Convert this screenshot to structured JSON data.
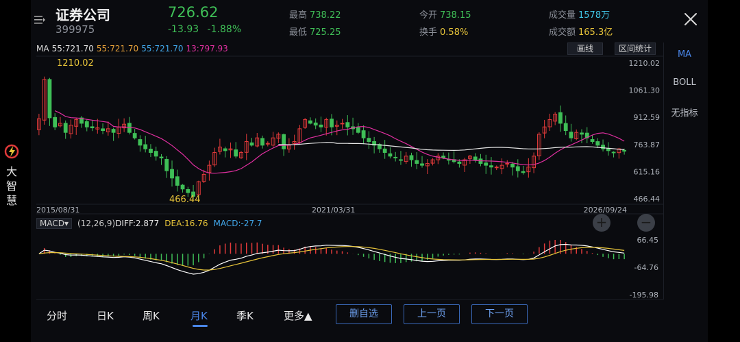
{
  "brand": {
    "chars": [
      "大",
      "智",
      "慧"
    ],
    "logo_icon": "lightning-logo-icon"
  },
  "header": {
    "name": "证券公司",
    "code": "399975",
    "price": "726.62",
    "change": "-13.93",
    "change_pct": "-1.88%",
    "high_label": "最高",
    "high": "738.22",
    "low_label": "最低",
    "low": "725.25",
    "open_label": "今开",
    "open": "738.15",
    "turnover_label": "换手",
    "turnover": "0.58%",
    "volume_label": "成交量",
    "volume": "1578万",
    "amount_label": "成交额",
    "amount": "165.3亿"
  },
  "ma_legend": {
    "label": "MA",
    "items": [
      {
        "text": "55:721.70",
        "color": "#e0e0e0"
      },
      {
        "text": "55:721.70",
        "color": "#e8a23a"
      },
      {
        "text": "55:721.70",
        "color": "#41a6e8"
      },
      {
        "text": "13:797.93",
        "color": "#e02fa0"
      }
    ]
  },
  "tools": {
    "draw": "画线",
    "range": "区间统计"
  },
  "indicators": [
    {
      "label": "MA",
      "active": true
    },
    {
      "label": "BOLL",
      "active": false
    },
    {
      "label": "无指标",
      "active": false
    }
  ],
  "macd": {
    "select_label": "MACD",
    "params": "(12,26,9)",
    "diff": "DIFF:2.877",
    "dea": "DEA:16.76",
    "macd": "MACD:-27.7",
    "zoom_in": "+",
    "zoom_out": "−"
  },
  "tabs": [
    {
      "label": "分时",
      "active": false
    },
    {
      "label": "日K",
      "active": false
    },
    {
      "label": "周K",
      "active": false
    },
    {
      "label": "月K",
      "active": true
    },
    {
      "label": "季K",
      "active": false
    },
    {
      "label": "更多▲",
      "active": false
    }
  ],
  "actions": {
    "remove_fav": "删自选",
    "prev": "上一页",
    "next": "下一页"
  },
  "chart_data": {
    "type": "candlestick",
    "price_axis": [
      "1210.02",
      "1061.30",
      "912.59",
      "763.87",
      "615.16",
      "466.44"
    ],
    "price_range": [
      466.44,
      1210.02
    ],
    "dates": [
      "2015/08/31",
      "2021/03/31",
      "2026/09/24"
    ],
    "annotations": {
      "max": "1210.02",
      "min": "466.44"
    },
    "macd_axis": [
      "66.45",
      "-64.76",
      "-195.98"
    ],
    "macd_range": [
      -195.98,
      66.45
    ],
    "colors": {
      "up": "#e23a3a",
      "down": "#3fbf57",
      "ma_white": "#e6e6e6",
      "ma13": "#e02fa0",
      "dif": "#ffffff",
      "dea": "#e8c53a"
    },
    "close": [
      905,
      1120,
      910,
      860,
      880,
      830,
      870,
      900,
      880,
      860,
      855,
      855,
      840,
      850,
      830,
      860,
      875,
      830,
      800,
      760,
      740,
      720,
      700,
      690,
      620,
      580,
      540,
      520,
      500,
      480,
      560,
      600,
      650,
      720,
      750,
      730,
      740,
      700,
      720,
      780,
      760,
      800,
      760,
      770,
      800,
      820,
      740,
      760,
      780,
      850,
      900,
      880,
      870,
      860,
      900,
      860,
      870,
      880,
      860,
      850,
      830,
      800,
      780,
      760,
      740,
      720,
      700,
      690,
      680,
      700,
      680,
      660,
      650,
      660,
      680,
      700,
      690,
      680,
      670,
      660,
      680,
      700,
      680,
      660,
      650,
      640,
      640,
      650,
      660,
      640,
      620,
      610,
      640,
      700,
      820,
      860,
      900,
      930,
      880,
      840,
      800,
      830,
      820,
      800,
      780,
      760,
      740,
      730,
      720,
      740,
      727
    ]
  }
}
